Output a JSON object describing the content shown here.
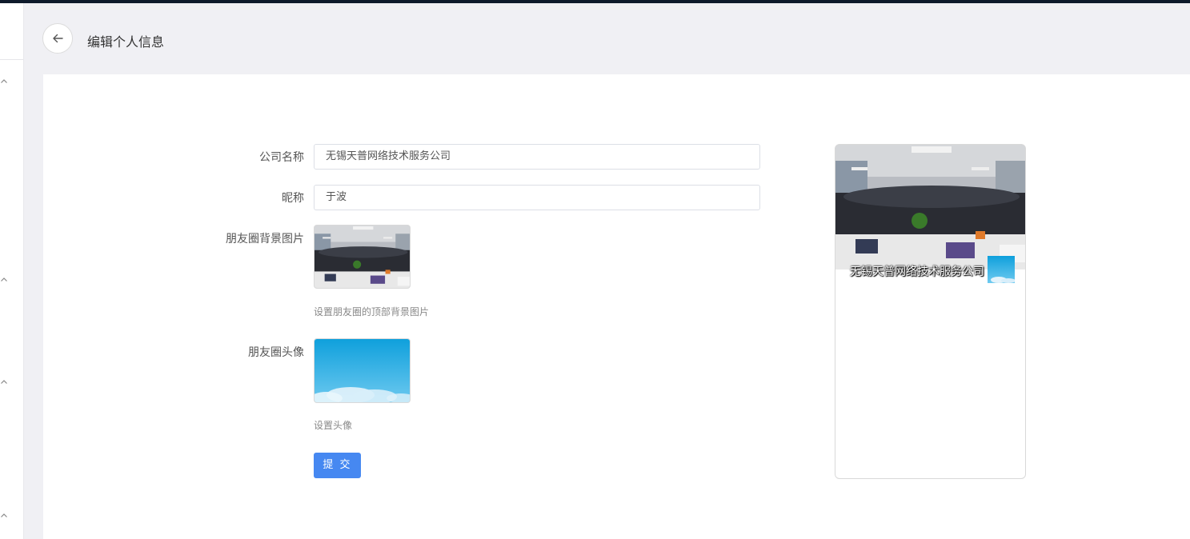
{
  "header": {
    "back_icon": "arrow-left-icon",
    "title": "编辑个人信息"
  },
  "sidebar": {
    "chevron_icon": "chevron-up-icon"
  },
  "form": {
    "company": {
      "label": "公司名称",
      "value": "无锡天普网络技术服务公司"
    },
    "nickname": {
      "label": "昵称",
      "value": "于波"
    },
    "background": {
      "label": "朋友圈背景图片",
      "hint": "设置朋友圈的顶部背景图片"
    },
    "avatar": {
      "label": "朋友圈头像",
      "hint": "设置头像"
    },
    "submit_label": "提 交"
  },
  "preview": {
    "name": "无锡天普网络技术服务公司"
  },
  "colors": {
    "primary": "#4688f1",
    "sky": "#1fa8e0"
  }
}
